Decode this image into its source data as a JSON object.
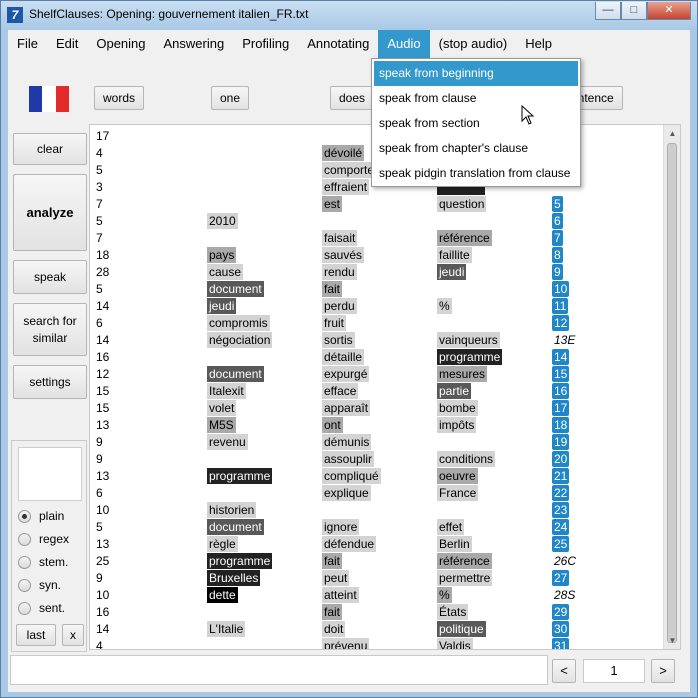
{
  "window": {
    "title": "ShelfClauses: Opening: gouvernement italien_FR.txt",
    "icon_letter": "7"
  },
  "menu": {
    "items": [
      "File",
      "Edit",
      "Opening",
      "Answering",
      "Profiling",
      "Annotating",
      "Audio",
      "(stop audio)",
      "Help"
    ],
    "active": "Audio"
  },
  "audio_menu": {
    "items": [
      "speak from beginning",
      "speak from clause",
      "speak from section",
      "speak from chapter's clause",
      "speak pidgin translation from clause"
    ],
    "active_index": 0
  },
  "toolbar": {
    "words_label": "words",
    "one_label": "one",
    "does_label": "does",
    "sentence_label": "entence"
  },
  "flag": {
    "colors": [
      "#1f3aa6",
      "#ffffff",
      "#e32b2b"
    ]
  },
  "sidebar": {
    "clear": "clear",
    "analyze": "analyze",
    "speak": "speak",
    "search_for_similar": "search for similar",
    "settings": "settings",
    "radios": [
      "plain",
      "regex",
      "stem.",
      "syn.",
      "sent."
    ],
    "selected_radio": "plain",
    "last": "last",
    "x": "x"
  },
  "results": {
    "rows": [
      {
        "n": "17",
        "a": "",
        "ah": 0,
        "b": "",
        "bh": 0,
        "c": "",
        "ch": 0,
        "idx": "",
        "it": "none"
      },
      {
        "n": "4",
        "a": "",
        "ah": 0,
        "b": "dévoilé",
        "bh": 2,
        "c": "",
        "ch": 0,
        "idx": "",
        "it": "none"
      },
      {
        "n": "5",
        "a": "",
        "ah": 0,
        "b": "comporte",
        "bh": 1,
        "c": "",
        "ch": 0,
        "idx": "",
        "it": "none"
      },
      {
        "n": "3",
        "a": "",
        "ah": 0,
        "b": "effraient",
        "bh": 1,
        "c": "",
        "ch": 4,
        "idx": "",
        "it": "none"
      },
      {
        "n": "7",
        "a": "",
        "ah": 0,
        "b": "est",
        "bh": 2,
        "c": "question",
        "ch": 1,
        "idx": "5",
        "it": "blue"
      },
      {
        "n": "5",
        "a": "2010",
        "ah": 1,
        "b": "",
        "bh": 0,
        "c": "",
        "ch": 0,
        "idx": "6",
        "it": "blue"
      },
      {
        "n": "7",
        "a": "",
        "ah": 0,
        "b": "faisait",
        "bh": 1,
        "c": "référence",
        "ch": 2,
        "idx": "7",
        "it": "blue"
      },
      {
        "n": "18",
        "a": "pays",
        "ah": 2,
        "b": "sauvés",
        "bh": 1,
        "c": "faillite",
        "ch": 1,
        "idx": "8",
        "it": "blue"
      },
      {
        "n": "28",
        "a": "cause",
        "ah": 1,
        "b": "rendu",
        "bh": 1,
        "c": "jeudi",
        "ch": 3,
        "idx": "9",
        "it": "blue"
      },
      {
        "n": "5",
        "a": "document",
        "ah": 3,
        "b": "fait",
        "bh": 2,
        "c": "",
        "ch": 0,
        "idx": "10",
        "it": "blue"
      },
      {
        "n": "14",
        "a": "jeudi",
        "ah": 3,
        "b": "perdu",
        "bh": 1,
        "c": "%",
        "ch": 1,
        "idx": "11",
        "it": "blue"
      },
      {
        "n": "6",
        "a": "compromis",
        "ah": 1,
        "b": "fruit",
        "bh": 1,
        "c": "",
        "ch": 0,
        "idx": "12",
        "it": "blue"
      },
      {
        "n": "14",
        "a": "négociation",
        "ah": 1,
        "b": "sortis",
        "bh": 1,
        "c": "vainqueurs",
        "ch": 1,
        "idx": "13E",
        "it": "plain"
      },
      {
        "n": "16",
        "a": "",
        "ah": 0,
        "b": "détaille",
        "bh": 1,
        "c": "programme",
        "ch": 4,
        "idx": "14",
        "it": "blue"
      },
      {
        "n": "12",
        "a": "document",
        "ah": 3,
        "b": "expurgé",
        "bh": 1,
        "c": "mesures",
        "ch": 2,
        "idx": "15",
        "it": "blue"
      },
      {
        "n": "15",
        "a": "Italexit",
        "ah": 1,
        "b": "efface",
        "bh": 1,
        "c": "partie",
        "ch": 3,
        "idx": "16",
        "it": "blue"
      },
      {
        "n": "15",
        "a": "volet",
        "ah": 1,
        "b": "apparaît",
        "bh": 1,
        "c": "bombe",
        "ch": 1,
        "idx": "17",
        "it": "blue"
      },
      {
        "n": "13",
        "a": "M5S",
        "ah": 2,
        "b": "ont",
        "bh": 2,
        "c": "impôts",
        "ch": 1,
        "idx": "18",
        "it": "blue"
      },
      {
        "n": "9",
        "a": "revenu",
        "ah": 1,
        "b": "démunis",
        "bh": 1,
        "c": "",
        "ch": 0,
        "idx": "19",
        "it": "blue"
      },
      {
        "n": "9",
        "a": "",
        "ah": 0,
        "b": "assouplir",
        "bh": 1,
        "c": "conditions",
        "ch": 1,
        "idx": "20",
        "it": "blue"
      },
      {
        "n": "13",
        "a": "programme",
        "ah": 4,
        "b": "compliqué",
        "bh": 1,
        "c": "oeuvre",
        "ch": 2,
        "idx": "21",
        "it": "blue"
      },
      {
        "n": "6",
        "a": "",
        "ah": 0,
        "b": "explique",
        "bh": 1,
        "c": "France",
        "ch": 1,
        "idx": "22",
        "it": "blue"
      },
      {
        "n": "10",
        "a": "historien",
        "ah": 1,
        "b": "",
        "bh": 0,
        "c": "",
        "ch": 0,
        "idx": "23",
        "it": "blue"
      },
      {
        "n": "5",
        "a": "document",
        "ah": 3,
        "b": "ignore",
        "bh": 1,
        "c": "effet",
        "ch": 1,
        "idx": "24",
        "it": "blue"
      },
      {
        "n": "13",
        "a": "règle",
        "ah": 1,
        "b": "défendue",
        "bh": 1,
        "c": "Berlin",
        "ch": 1,
        "idx": "25",
        "it": "blue"
      },
      {
        "n": "25",
        "a": "programme",
        "ah": 4,
        "b": "fait",
        "bh": 2,
        "c": "référence",
        "ch": 2,
        "idx": "26C",
        "it": "plain"
      },
      {
        "n": "9",
        "a": "Bruxelles",
        "ah": 4,
        "b": "peut",
        "bh": 1,
        "c": "permettre",
        "ch": 1,
        "idx": "27",
        "it": "blue"
      },
      {
        "n": "10",
        "a": "dette",
        "ah": 5,
        "b": "atteint",
        "bh": 1,
        "c": "%",
        "ch": 2,
        "idx": "28S",
        "it": "plain"
      },
      {
        "n": "16",
        "a": "",
        "ah": 0,
        "b": "fait",
        "bh": 2,
        "c": "États",
        "ch": 1,
        "idx": "29",
        "it": "blue"
      },
      {
        "n": "14",
        "a": "L'Italie",
        "ah": 1,
        "b": "doit",
        "bh": 1,
        "c": "politique",
        "ch": 3,
        "idx": "30",
        "it": "blue"
      },
      {
        "n": "4",
        "a": "",
        "ah": 0,
        "b": "prévenu",
        "bh": 1,
        "c": "Valdis",
        "ch": 1,
        "idx": "31",
        "it": "blue"
      }
    ]
  },
  "bottom": {
    "prev": "<",
    "next": ">",
    "page": "1"
  }
}
